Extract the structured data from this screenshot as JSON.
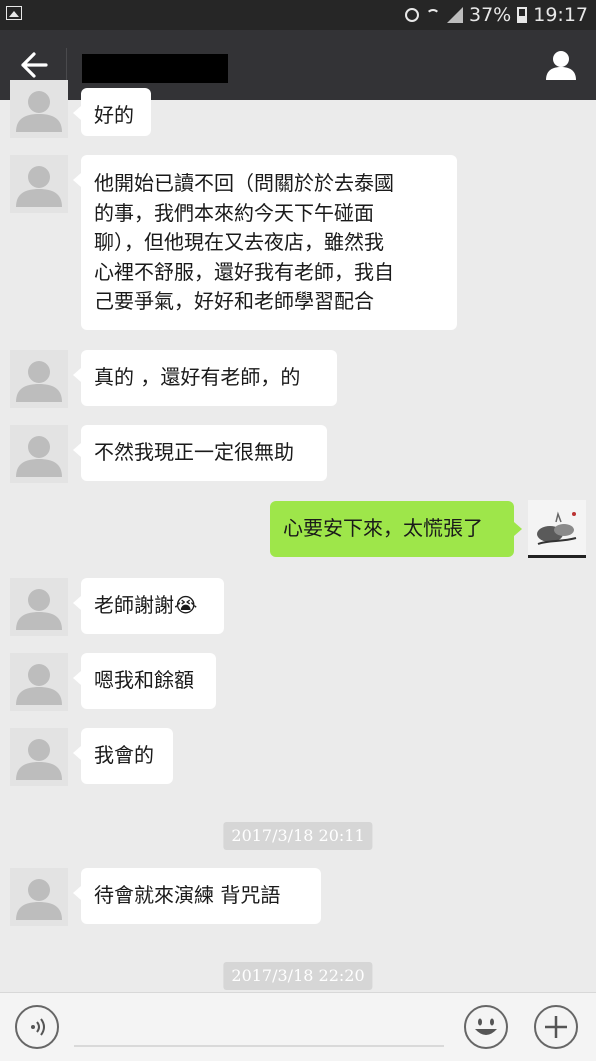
{
  "status_bar": {
    "battery_percent": "37%",
    "time": "19:17",
    "icons": [
      "image-icon",
      "alarm-icon",
      "wifi-icon",
      "signal-icon",
      "battery-icon"
    ]
  },
  "header": {
    "contact_name_redacted": "",
    "icons": [
      "back-arrow-icon",
      "profile-icon"
    ]
  },
  "messages": [
    {
      "side": "left",
      "text": "好的"
    },
    {
      "side": "left",
      "lines": [
        "他開始已讀不回（問關於於去泰國",
        "的事，我們本來約今天下午碰面",
        "聊），但他現在又去夜店，雖然我",
        "心裡不舒服，還好我有老師，我自",
        "己要爭氣，好好和老師學習配合"
      ]
    },
    {
      "side": "left",
      "text": "真的 ，還好有老師，的"
    },
    {
      "side": "left",
      "text": "不然我現正一定很無助"
    },
    {
      "side": "right",
      "text": "心要安下來，太慌張了"
    },
    {
      "side": "left",
      "text": "老師謝謝",
      "emoji": "😭"
    },
    {
      "side": "left",
      "text": "嗯我和餘額"
    },
    {
      "side": "left",
      "text": "我會的"
    },
    {
      "side": "time",
      "text": "2017/3/18 20:11"
    },
    {
      "side": "left",
      "text": "待會就來演練 背咒語"
    },
    {
      "side": "time",
      "text": "2017/3/18 22:20"
    }
  ],
  "input_bar": {
    "icons": [
      "voice-icon",
      "emoji-icon",
      "plus-icon"
    ]
  },
  "colors": {
    "background": "#ebebeb",
    "title_bar": "#333336",
    "status_bar": "#262626",
    "bubble_left": "#ffffff",
    "bubble_right": "#9ee64a"
  }
}
